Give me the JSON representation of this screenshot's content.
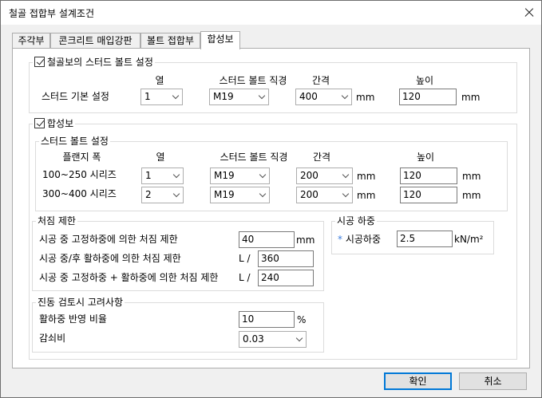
{
  "window": {
    "title": "철골 접합부 설계조건"
  },
  "tabs": [
    {
      "label": "주각부"
    },
    {
      "label": "콘크리트 매입강판"
    },
    {
      "label": "볼트 접합부"
    },
    {
      "label": "합성보"
    }
  ],
  "steel_beam_stud": {
    "title": "철골보의 스터드 볼트 설정",
    "checked": true,
    "headers": {
      "row": "열",
      "diameter": "스터드 볼트 직경",
      "spacing": "간격",
      "height": "높이"
    },
    "row_label": "스터드 기본 설정",
    "row": "1",
    "diameter": "M19",
    "spacing": "400",
    "spacing_unit": "mm",
    "height": "120",
    "height_unit": "mm"
  },
  "composite_beam": {
    "title": "합성보",
    "checked": true,
    "stud_settings": {
      "title": "스터드 볼트 설정",
      "headers": {
        "flange": "플랜지 폭",
        "row": "열",
        "diameter": "스터드 볼트 직경",
        "spacing": "간격",
        "height": "높이"
      },
      "rows": [
        {
          "label": "100~250 시리즈",
          "row": "1",
          "diameter": "M19",
          "spacing": "200",
          "spacing_unit": "mm",
          "height": "120",
          "height_unit": "mm"
        },
        {
          "label": "300~400 시리즈",
          "row": "2",
          "diameter": "M19",
          "spacing": "200",
          "spacing_unit": "mm",
          "height": "120",
          "height_unit": "mm"
        }
      ]
    },
    "deflection": {
      "title": "처짐 제한",
      "dead_load_label": "시공 중 고정하중에 의한 처짐 제한",
      "dead_load_value": "40",
      "dead_load_unit": "mm",
      "live_load_label": "시공 중/후 활하중에 의한 처짐 제한",
      "live_load_prefix": "L /",
      "live_load_value": "360",
      "combined_label": "시공 중 고정하중 + 활하중에 의한 처짐 제한",
      "combined_prefix": "L /",
      "combined_value": "240"
    },
    "construction_load": {
      "title": "시공 하중",
      "required_mark": "*",
      "label": "시공하중",
      "value": "2.5",
      "unit": "kN/m²"
    },
    "vibration": {
      "title": "진동 검토시 고려사항",
      "live_ratio_label": "활하중 반영 비율",
      "live_ratio_value": "10",
      "live_ratio_unit": "%",
      "damping_label": "감쇠비",
      "damping_value": "0.03"
    }
  },
  "buttons": {
    "ok": "확인",
    "cancel": "취소"
  }
}
